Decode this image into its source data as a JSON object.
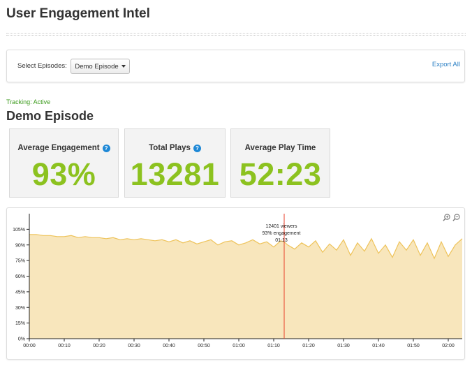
{
  "header": {
    "title": "User Engagement Intel"
  },
  "selector": {
    "label": "Select Episodes:",
    "selected": "Demo Episode",
    "export_label": "Export All"
  },
  "episode": {
    "tracking": "Tracking: Active",
    "title": "Demo Episode"
  },
  "stats": [
    {
      "label": "Average Engagement",
      "value": "93%",
      "help": true
    },
    {
      "label": "Total Plays",
      "value": "13281",
      "help": true
    },
    {
      "label": "Average Play Time",
      "value": "52:23",
      "help": false
    }
  ],
  "colors": {
    "stat_value": "#8cc21f",
    "area_fill": "#f8e6bc",
    "area_line": "#eec35a",
    "marker": "#e8412c",
    "link": "#2a7fc4",
    "tracking": "#3a9a1a"
  },
  "tooltip": {
    "viewers": "12401 viewers",
    "engagement": "93% engagement",
    "time": "01:13"
  },
  "chart_data": {
    "type": "area",
    "xlabel": "",
    "ylabel": "",
    "y_ticks": [
      "0%",
      "15%",
      "30%",
      "45%",
      "60%",
      "75%",
      "90%",
      "105%"
    ],
    "x_ticks": [
      "00:00",
      "00:10",
      "00:20",
      "00:30",
      "00:40",
      "00:50",
      "01:00",
      "01:10",
      "01:20",
      "01:30",
      "01:40",
      "01:50",
      "02:00"
    ],
    "ylim": [
      0,
      1.2
    ],
    "xlim_minutes": [
      0,
      124
    ],
    "marker_minute": 73,
    "series": [
      {
        "x": [
          0,
          2,
          4,
          6,
          8,
          10,
          12,
          14,
          16,
          18,
          20,
          22,
          24,
          26,
          28,
          30,
          32,
          34,
          36,
          38,
          40,
          42,
          44,
          46,
          48,
          50,
          52,
          54,
          56,
          58,
          60,
          62,
          64,
          66,
          68,
          70,
          72,
          73,
          74,
          76,
          78,
          80,
          82,
          84,
          86,
          88,
          90,
          92,
          94,
          96,
          98,
          100,
          102,
          104,
          106,
          108,
          110,
          112,
          114,
          116,
          118,
          120,
          122,
          124
        ],
        "y": [
          1.0,
          1.0,
          0.99,
          0.99,
          0.98,
          0.98,
          0.99,
          0.97,
          0.98,
          0.97,
          0.97,
          0.96,
          0.97,
          0.95,
          0.96,
          0.95,
          0.96,
          0.95,
          0.94,
          0.95,
          0.93,
          0.95,
          0.92,
          0.94,
          0.91,
          0.93,
          0.95,
          0.9,
          0.93,
          0.94,
          0.9,
          0.92,
          0.95,
          0.91,
          0.93,
          0.88,
          0.94,
          0.93,
          0.9,
          0.86,
          0.92,
          0.88,
          0.94,
          0.83,
          0.91,
          0.85,
          0.95,
          0.8,
          0.92,
          0.84,
          0.96,
          0.82,
          0.9,
          0.78,
          0.93,
          0.85,
          0.95,
          0.8,
          0.92,
          0.77,
          0.93,
          0.79,
          0.9,
          0.96
        ]
      }
    ]
  }
}
